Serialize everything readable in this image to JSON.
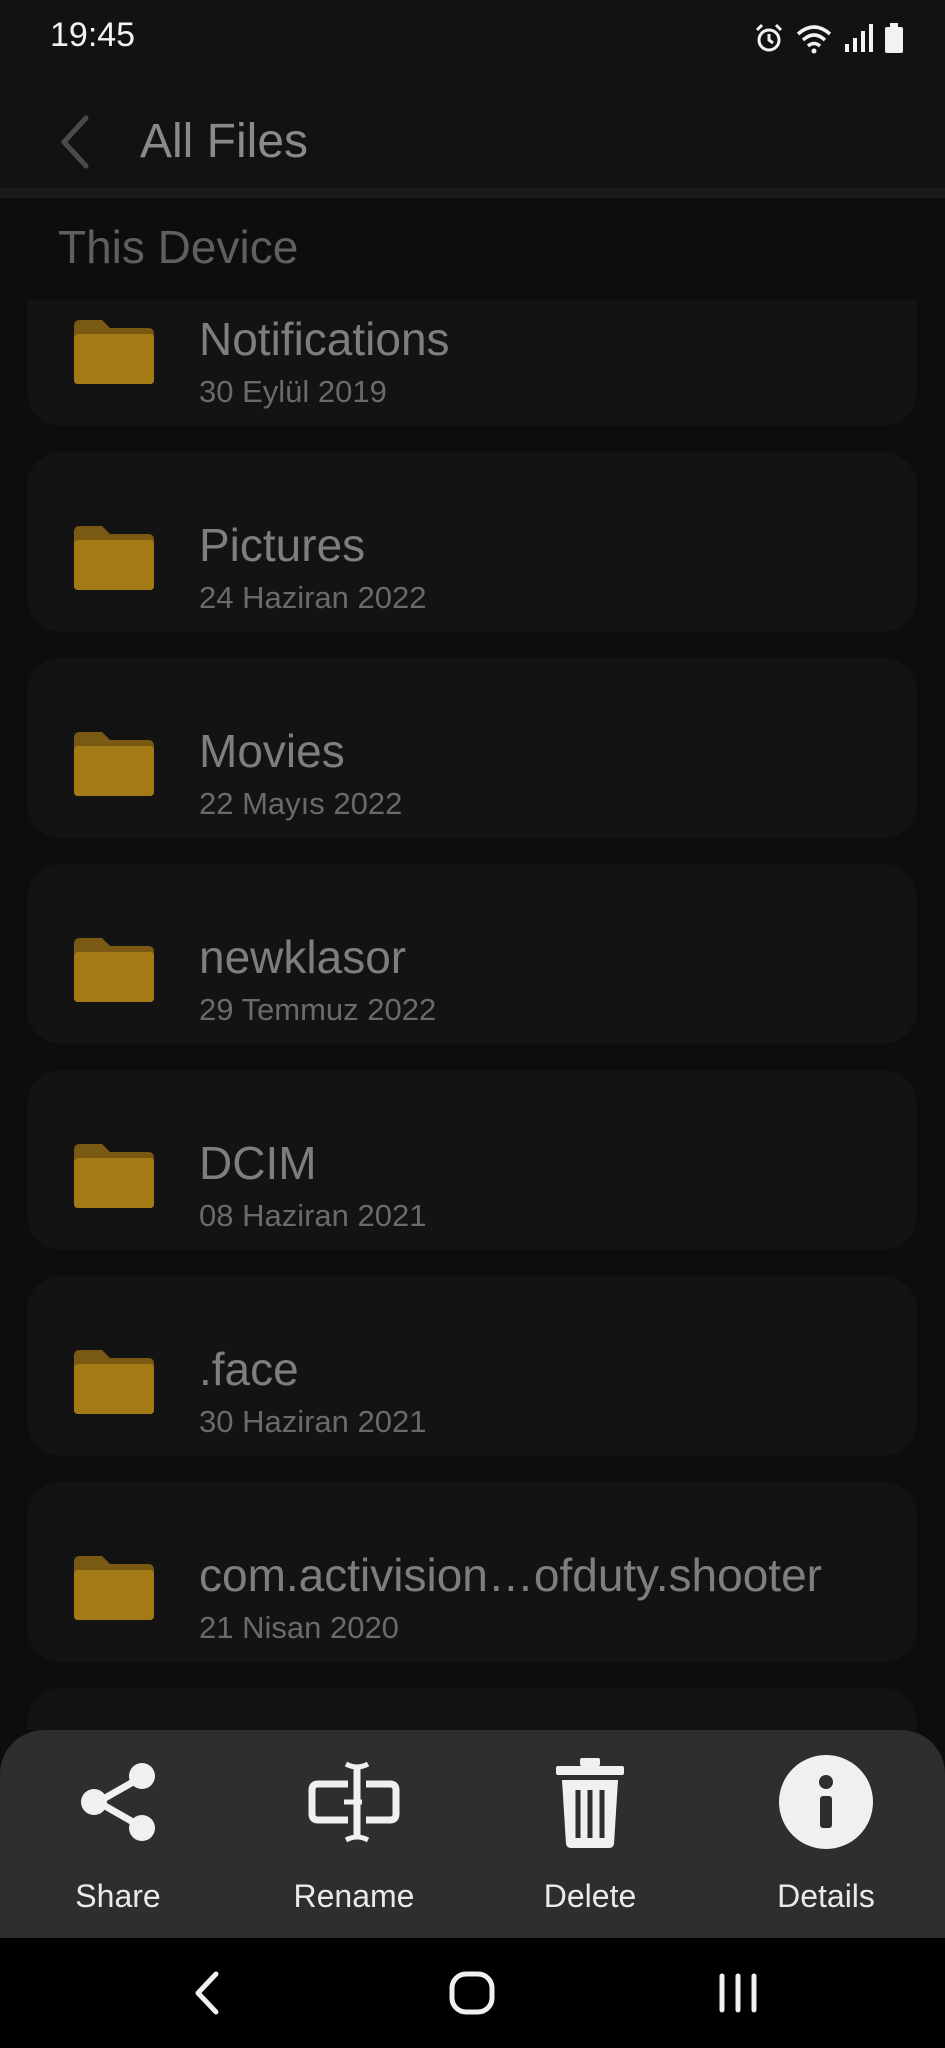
{
  "status_bar": {
    "time": "19:45",
    "icons": [
      "alarm-icon",
      "wifi-icon",
      "signal-icon",
      "battery-icon"
    ]
  },
  "header": {
    "title": "All Files",
    "back_icon": "chevron-left-icon"
  },
  "section": {
    "label": "This Device"
  },
  "files": [
    {
      "name": "Notifications",
      "date": "30 Eylül 2019"
    },
    {
      "name": "Pictures",
      "date": "24 Haziran 2022"
    },
    {
      "name": "Movies",
      "date": "22 Mayıs 2022"
    },
    {
      "name": "newklasor",
      "date": "29 Temmuz 2022"
    },
    {
      "name": "DCIM",
      "date": "08 Haziran 2021"
    },
    {
      "name": ".face",
      "date": "30 Haziran 2021"
    },
    {
      "name": "com.activision…ofduty.shooter",
      "date": "21 Nisan 2020"
    }
  ],
  "actions": [
    {
      "label": "Share",
      "icon": "share-icon"
    },
    {
      "label": "Rename",
      "icon": "rename-icon"
    },
    {
      "label": "Delete",
      "icon": "trash-icon"
    },
    {
      "label": "Details",
      "icon": "info-icon"
    }
  ],
  "nav": {
    "icons": [
      "nav-back-icon",
      "nav-home-icon",
      "nav-recents-icon"
    ]
  },
  "colors": {
    "background": "#0d0d0d",
    "folder": "#b8860b",
    "sheet": "#2e2e2e"
  }
}
